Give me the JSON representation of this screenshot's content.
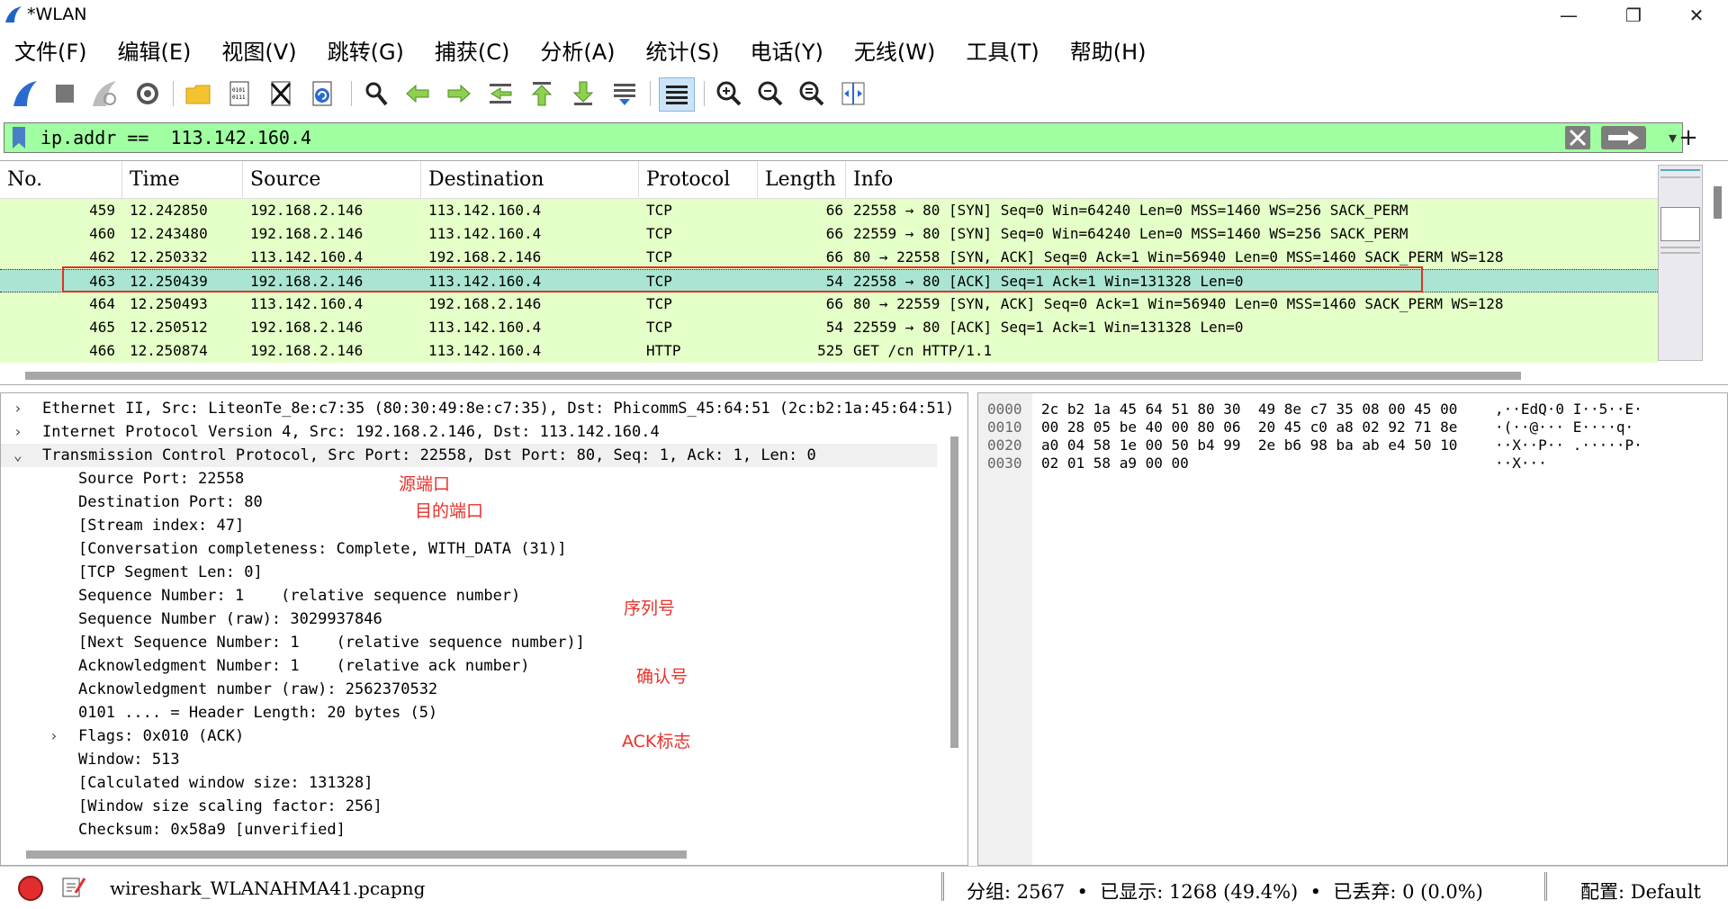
{
  "window": {
    "title": "*WLAN",
    "minimize": "—",
    "maximize": "❐",
    "close": "✕"
  },
  "menu": [
    "文件(F)",
    "编辑(E)",
    "视图(V)",
    "跳转(G)",
    "捕获(C)",
    "分析(A)",
    "统计(S)",
    "电话(Y)",
    "无线(W)",
    "工具(T)",
    "帮助(H)"
  ],
  "filter": {
    "value": "ip.addr ==  113.142.160.4",
    "add": "+"
  },
  "packet_list": {
    "columns": [
      "No.",
      "Time",
      "Source",
      "Destination",
      "Protocol",
      "Length",
      "Info"
    ],
    "rows": [
      {
        "no": "459",
        "time": "12.242850",
        "src": "192.168.2.146",
        "dst": "113.142.160.4",
        "proto": "TCP",
        "len": "66",
        "info": "22558 → 80 [SYN] Seq=0 Win=64240 Len=0 MSS=1460 WS=256 SACK_PERM",
        "selected": false
      },
      {
        "no": "460",
        "time": "12.243480",
        "src": "192.168.2.146",
        "dst": "113.142.160.4",
        "proto": "TCP",
        "len": "66",
        "info": "22559 → 80 [SYN] Seq=0 Win=64240 Len=0 MSS=1460 WS=256 SACK_PERM",
        "selected": false
      },
      {
        "no": "462",
        "time": "12.250332",
        "src": "113.142.160.4",
        "dst": "192.168.2.146",
        "proto": "TCP",
        "len": "66",
        "info": "80 → 22558 [SYN, ACK] Seq=0 Ack=1 Win=56940 Len=0 MSS=1460 SACK_PERM WS=128",
        "selected": false
      },
      {
        "no": "463",
        "time": "12.250439",
        "src": "192.168.2.146",
        "dst": "113.142.160.4",
        "proto": "TCP",
        "len": "54",
        "info": "22558 → 80 [ACK] Seq=1 Ack=1 Win=131328 Len=0",
        "selected": true
      },
      {
        "no": "464",
        "time": "12.250493",
        "src": "113.142.160.4",
        "dst": "192.168.2.146",
        "proto": "TCP",
        "len": "66",
        "info": "80 → 22559 [SYN, ACK] Seq=0 Ack=1 Win=56940 Len=0 MSS=1460 SACK_PERM WS=128",
        "selected": false
      },
      {
        "no": "465",
        "time": "12.250512",
        "src": "192.168.2.146",
        "dst": "113.142.160.4",
        "proto": "TCP",
        "len": "54",
        "info": "22559 → 80 [ACK] Seq=1 Ack=1 Win=131328 Len=0",
        "selected": false
      },
      {
        "no": "466",
        "time": "12.250874",
        "src": "192.168.2.146",
        "dst": "113.142.160.4",
        "proto": "HTTP",
        "len": "525",
        "info": "GET /cn HTTP/1.1",
        "selected": false
      }
    ]
  },
  "details": [
    {
      "text": "Ethernet II, Src: LiteonTe_8e:c7:35 (80:30:49:8e:c7:35), Dst: PhicommS_45:64:51 (2c:b2:1a:45:64:51)",
      "level": 0,
      "arrow": "›"
    },
    {
      "text": "Internet Protocol Version 4, Src: 192.168.2.146, Dst: 113.142.160.4",
      "level": 0,
      "arrow": "›"
    },
    {
      "text": "Transmission Control Protocol, Src Port: 22558, Dst Port: 80, Seq: 1, Ack: 1, Len: 0",
      "level": 0,
      "arrow": "⌄",
      "highlight": true
    },
    {
      "text": "Source Port: 22558",
      "level": 1,
      "arrow": ""
    },
    {
      "text": "Destination Port: 80",
      "level": 1,
      "arrow": ""
    },
    {
      "text": "[Stream index: 47]",
      "level": 1,
      "arrow": ""
    },
    {
      "text": "[Conversation completeness: Complete, WITH_DATA (31)]",
      "level": 1,
      "arrow": ""
    },
    {
      "text": "[TCP Segment Len: 0]",
      "level": 1,
      "arrow": ""
    },
    {
      "text": "Sequence Number: 1    (relative sequence number)",
      "level": 1,
      "arrow": ""
    },
    {
      "text": "Sequence Number (raw): 3029937846",
      "level": 1,
      "arrow": ""
    },
    {
      "text": "[Next Sequence Number: 1    (relative sequence number)]",
      "level": 1,
      "arrow": ""
    },
    {
      "text": "Acknowledgment Number: 1    (relative ack number)",
      "level": 1,
      "arrow": ""
    },
    {
      "text": "Acknowledgment number (raw): 2562370532",
      "level": 1,
      "arrow": ""
    },
    {
      "text": "0101 .... = Header Length: 20 bytes (5)",
      "level": 1,
      "arrow": ""
    },
    {
      "text": "Flags: 0x010 (ACK)",
      "level": 1,
      "arrow": "›"
    },
    {
      "text": "Window: 513",
      "level": 1,
      "arrow": ""
    },
    {
      "text": "[Calculated window size: 131328]",
      "level": 1,
      "arrow": ""
    },
    {
      "text": "[Window size scaling factor: 256]",
      "level": 1,
      "arrow": ""
    },
    {
      "text": "Checksum: 0x58a9 [unverified]",
      "level": 1,
      "arrow": ""
    }
  ],
  "annotations": {
    "source_port": "源端口",
    "dest_port": "目的端口",
    "seq": "序列号",
    "ack": "确认号",
    "ack_flag": "ACK标志"
  },
  "bytes": [
    {
      "offset": "0000",
      "hex": "2c b2 1a 45 64 51 80 30  49 8e c7 35 08 00 45 00",
      "ascii": ",··EdQ·0 I··5··E·"
    },
    {
      "offset": "0010",
      "hex": "00 28 05 be 40 00 80 06  20 45 c0 a8 02 92 71 8e",
      "ascii": "·(··@··· E····q·"
    },
    {
      "offset": "0020",
      "hex": "a0 04 58 1e 00 50 b4 99  2e b6 98 ba ab e4 50 10",
      "ascii": "··X··P·· .·····P·"
    },
    {
      "offset": "0030",
      "hex": "02 01 58 a9 00 00",
      "ascii": "··X···"
    }
  ],
  "status": {
    "file": "wireshark_WLANAHMA41.pcapng",
    "stats": "分组: 2567  •  已显示: 1268 (49.4%)  •  已丢弃: 0 (0.0%)",
    "profile": "配置: Default"
  },
  "colors": {
    "filter_ok": "#a0ffa0",
    "tcp_row": "#e4ffc7",
    "selected_row": "#a9e5d2",
    "annotation": "#e8302a"
  }
}
